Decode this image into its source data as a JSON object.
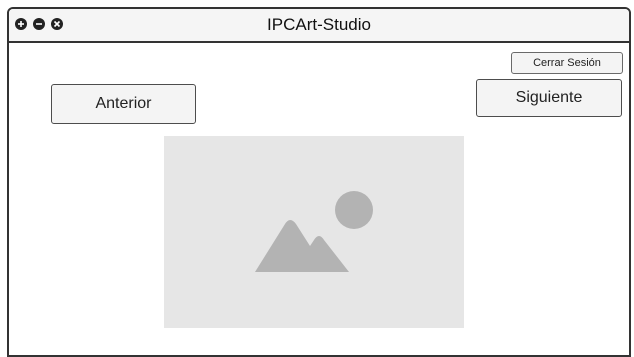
{
  "window": {
    "title": "IPCArt-Studio",
    "controls": [
      "maximize-icon",
      "minimize-icon",
      "close-icon"
    ]
  },
  "toolbar": {
    "logout_label": "Cerrar Sesión",
    "previous_label": "Anterior",
    "next_label": "Siguiente"
  },
  "main": {
    "image": {
      "icon": "image-placeholder-icon"
    }
  },
  "colors": {
    "window_border": "#333333",
    "button_background": "#f4f4f4",
    "placeholder_background": "#e6e6e6",
    "placeholder_icon": "#b3b3b3"
  }
}
